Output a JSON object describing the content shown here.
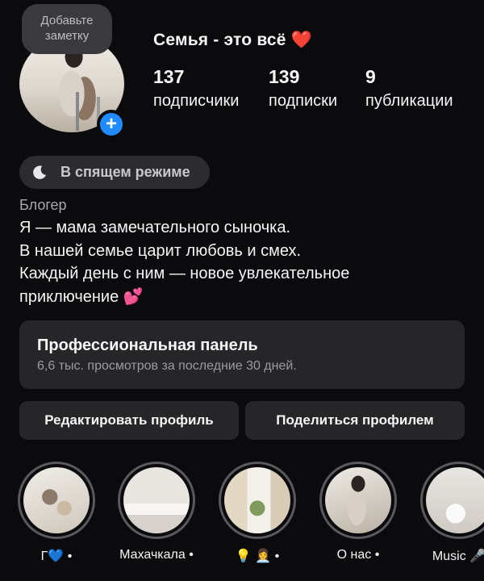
{
  "note": {
    "text_line1": "Добавьте",
    "text_line2": "заметку"
  },
  "profile": {
    "name": "Семья - это всё",
    "name_emoji": "❤️",
    "stats": [
      {
        "value": "137",
        "label": "подписчики"
      },
      {
        "value": "139",
        "label": "подписки"
      },
      {
        "value": "9",
        "label": "публикации"
      }
    ],
    "add_badge": "+"
  },
  "status": {
    "icon": "moon-icon",
    "label": "В спящем режиме"
  },
  "bio": {
    "category": "Блогер",
    "lines": [
      "Я — мама замечательного сыночка.",
      "В нашей семье царит любовь и смех.",
      "Каждый день с ним — новое увлекательное",
      "приключение 💕"
    ]
  },
  "pro_panel": {
    "title": "Профессиональная панель",
    "subtitle": "6,6 тыс. просмотров за последние 30 дней."
  },
  "actions": {
    "edit_label": "Редактировать профиль",
    "share_label": "Поделиться профилем"
  },
  "highlights": [
    {
      "caption": "Г💙 •"
    },
    {
      "caption": "Махачкала •"
    },
    {
      "caption": "💡 👩‍💼 •"
    },
    {
      "caption": "О нас •"
    },
    {
      "caption": "Music 🎤"
    }
  ],
  "colors": {
    "background": "#0b0b0d",
    "card": "#262628",
    "accent_blue": "#1f8bff",
    "heart_red": "#e4393c"
  }
}
